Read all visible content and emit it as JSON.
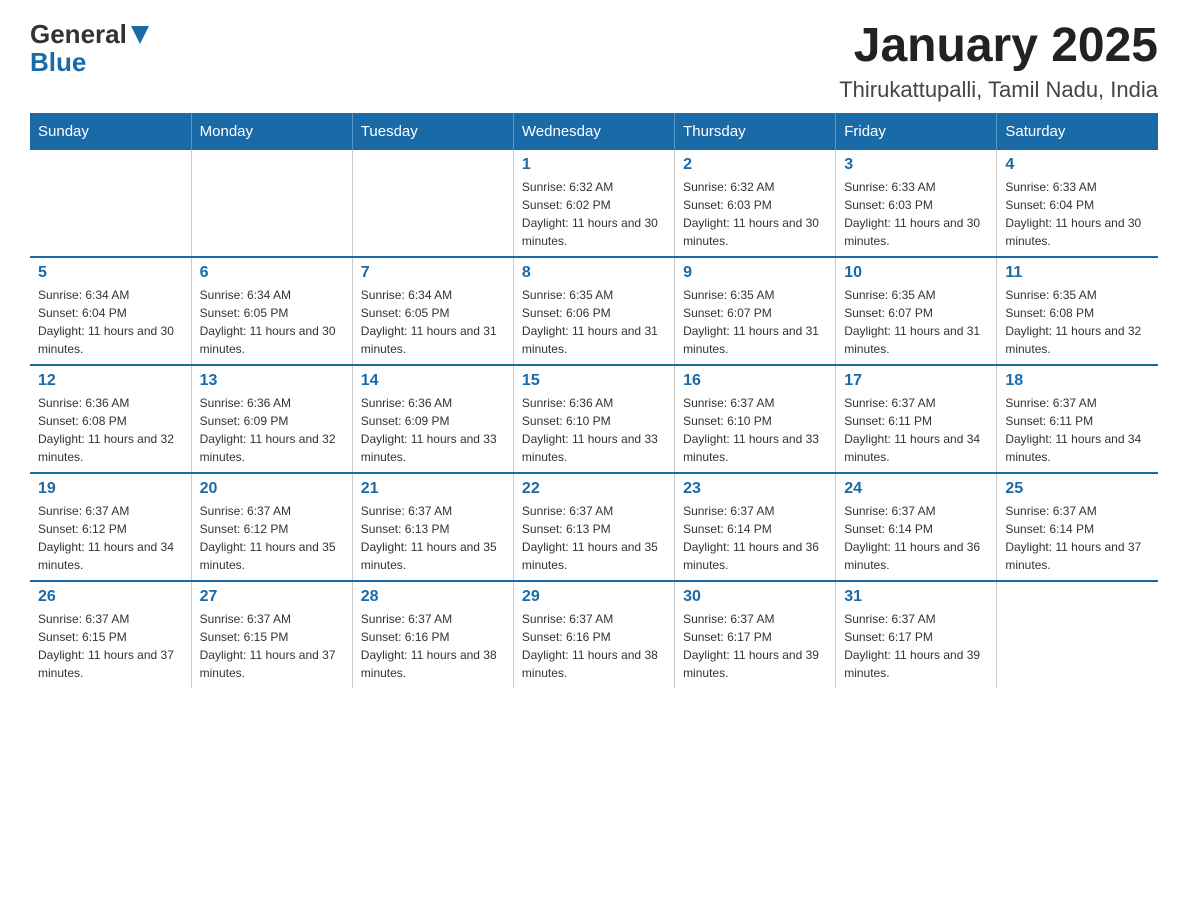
{
  "logo": {
    "text_general": "General",
    "text_blue": "Blue"
  },
  "title": "January 2025",
  "subtitle": "Thirukattupalli, Tamil Nadu, India",
  "days_of_week": [
    "Sunday",
    "Monday",
    "Tuesday",
    "Wednesday",
    "Thursday",
    "Friday",
    "Saturday"
  ],
  "weeks": [
    [
      {
        "day": "",
        "info": ""
      },
      {
        "day": "",
        "info": ""
      },
      {
        "day": "",
        "info": ""
      },
      {
        "day": "1",
        "info": "Sunrise: 6:32 AM\nSunset: 6:02 PM\nDaylight: 11 hours and 30 minutes."
      },
      {
        "day": "2",
        "info": "Sunrise: 6:32 AM\nSunset: 6:03 PM\nDaylight: 11 hours and 30 minutes."
      },
      {
        "day": "3",
        "info": "Sunrise: 6:33 AM\nSunset: 6:03 PM\nDaylight: 11 hours and 30 minutes."
      },
      {
        "day": "4",
        "info": "Sunrise: 6:33 AM\nSunset: 6:04 PM\nDaylight: 11 hours and 30 minutes."
      }
    ],
    [
      {
        "day": "5",
        "info": "Sunrise: 6:34 AM\nSunset: 6:04 PM\nDaylight: 11 hours and 30 minutes."
      },
      {
        "day": "6",
        "info": "Sunrise: 6:34 AM\nSunset: 6:05 PM\nDaylight: 11 hours and 30 minutes."
      },
      {
        "day": "7",
        "info": "Sunrise: 6:34 AM\nSunset: 6:05 PM\nDaylight: 11 hours and 31 minutes."
      },
      {
        "day": "8",
        "info": "Sunrise: 6:35 AM\nSunset: 6:06 PM\nDaylight: 11 hours and 31 minutes."
      },
      {
        "day": "9",
        "info": "Sunrise: 6:35 AM\nSunset: 6:07 PM\nDaylight: 11 hours and 31 minutes."
      },
      {
        "day": "10",
        "info": "Sunrise: 6:35 AM\nSunset: 6:07 PM\nDaylight: 11 hours and 31 minutes."
      },
      {
        "day": "11",
        "info": "Sunrise: 6:35 AM\nSunset: 6:08 PM\nDaylight: 11 hours and 32 minutes."
      }
    ],
    [
      {
        "day": "12",
        "info": "Sunrise: 6:36 AM\nSunset: 6:08 PM\nDaylight: 11 hours and 32 minutes."
      },
      {
        "day": "13",
        "info": "Sunrise: 6:36 AM\nSunset: 6:09 PM\nDaylight: 11 hours and 32 minutes."
      },
      {
        "day": "14",
        "info": "Sunrise: 6:36 AM\nSunset: 6:09 PM\nDaylight: 11 hours and 33 minutes."
      },
      {
        "day": "15",
        "info": "Sunrise: 6:36 AM\nSunset: 6:10 PM\nDaylight: 11 hours and 33 minutes."
      },
      {
        "day": "16",
        "info": "Sunrise: 6:37 AM\nSunset: 6:10 PM\nDaylight: 11 hours and 33 minutes."
      },
      {
        "day": "17",
        "info": "Sunrise: 6:37 AM\nSunset: 6:11 PM\nDaylight: 11 hours and 34 minutes."
      },
      {
        "day": "18",
        "info": "Sunrise: 6:37 AM\nSunset: 6:11 PM\nDaylight: 11 hours and 34 minutes."
      }
    ],
    [
      {
        "day": "19",
        "info": "Sunrise: 6:37 AM\nSunset: 6:12 PM\nDaylight: 11 hours and 34 minutes."
      },
      {
        "day": "20",
        "info": "Sunrise: 6:37 AM\nSunset: 6:12 PM\nDaylight: 11 hours and 35 minutes."
      },
      {
        "day": "21",
        "info": "Sunrise: 6:37 AM\nSunset: 6:13 PM\nDaylight: 11 hours and 35 minutes."
      },
      {
        "day": "22",
        "info": "Sunrise: 6:37 AM\nSunset: 6:13 PM\nDaylight: 11 hours and 35 minutes."
      },
      {
        "day": "23",
        "info": "Sunrise: 6:37 AM\nSunset: 6:14 PM\nDaylight: 11 hours and 36 minutes."
      },
      {
        "day": "24",
        "info": "Sunrise: 6:37 AM\nSunset: 6:14 PM\nDaylight: 11 hours and 36 minutes."
      },
      {
        "day": "25",
        "info": "Sunrise: 6:37 AM\nSunset: 6:14 PM\nDaylight: 11 hours and 37 minutes."
      }
    ],
    [
      {
        "day": "26",
        "info": "Sunrise: 6:37 AM\nSunset: 6:15 PM\nDaylight: 11 hours and 37 minutes."
      },
      {
        "day": "27",
        "info": "Sunrise: 6:37 AM\nSunset: 6:15 PM\nDaylight: 11 hours and 37 minutes."
      },
      {
        "day": "28",
        "info": "Sunrise: 6:37 AM\nSunset: 6:16 PM\nDaylight: 11 hours and 38 minutes."
      },
      {
        "day": "29",
        "info": "Sunrise: 6:37 AM\nSunset: 6:16 PM\nDaylight: 11 hours and 38 minutes."
      },
      {
        "day": "30",
        "info": "Sunrise: 6:37 AM\nSunset: 6:17 PM\nDaylight: 11 hours and 39 minutes."
      },
      {
        "day": "31",
        "info": "Sunrise: 6:37 AM\nSunset: 6:17 PM\nDaylight: 11 hours and 39 minutes."
      },
      {
        "day": "",
        "info": ""
      }
    ]
  ]
}
